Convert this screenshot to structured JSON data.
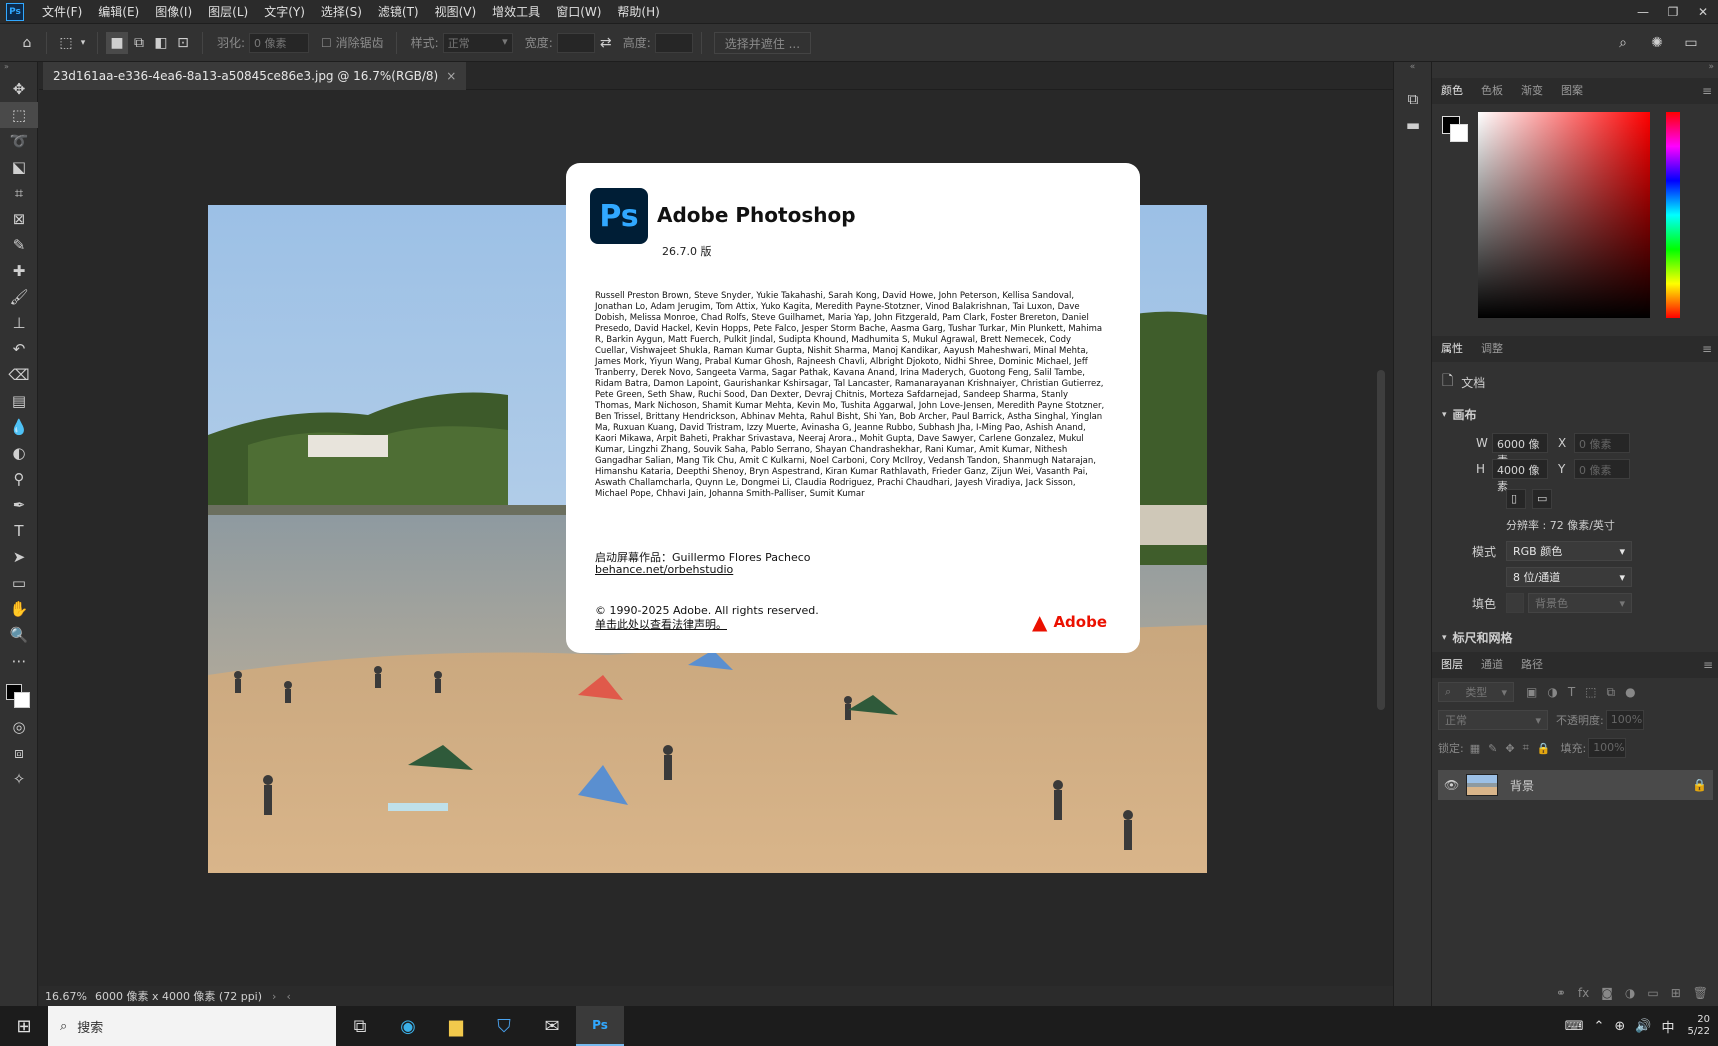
{
  "menubar": {
    "app_badge": "Ps",
    "items": [
      "文件(F)",
      "编辑(E)",
      "图像(I)",
      "图层(L)",
      "文字(Y)",
      "选择(S)",
      "滤镜(T)",
      "视图(V)",
      "增效工具",
      "窗口(W)",
      "帮助(H)"
    ],
    "win_minimize": "—",
    "win_restore": "❐",
    "win_close": "✕"
  },
  "options": {
    "feather_label": "羽化:",
    "feather_value": "0 像素",
    "antialias_label": "消除锯齿",
    "style_label": "样式:",
    "style_value": "正常",
    "width_label": "宽度:",
    "height_label": "高度:",
    "select_mask_button": "选择并遮住 ..."
  },
  "document": {
    "tab_title": "23d161aa-e336-4ea6-8a13-a50845ce86e3.jpg @ 16.7%(RGB/8)",
    "tab_close": "×",
    "zoom": "16.67%",
    "doc_size": "6000 像素 x 4000 像素 (72 ppi)"
  },
  "about": {
    "logo": "Ps",
    "title": "Adobe Photoshop",
    "version": "26.7.0 版",
    "credits": "Russell Preston Brown, Steve Snyder, Yukie Takahashi, Sarah Kong, David Howe, John Peterson, Kellisa Sandoval, Jonathan Lo, Adam Jerugim, Tom Attix, Yuko Kagita, Meredith Payne-Stotzner, Vinod Balakrishnan, Tai Luxon, Dave Dobish, Melissa Monroe, Chad Rolfs, Steve Guilhamet, Maria Yap, John Fitzgerald, Pam Clark, Foster Brereton, Daniel Presedo, David Hackel, Kevin Hopps, Pete Falco, Jesper Storm Bache, Aasma Garg, Tushar Turkar, Min Plunkett, Mahima R, Barkin Aygun, Matt Fuerch, Pulkit Jindal, Sudipta Khound, Madhumita S, Mukul Agrawal, Brett Nemecek, Cody Cuellar, Vishwajeet Shukla, Raman Kumar Gupta, Nishit Sharma, Manoj Kandikar, Aayush Maheshwari, Minal Mehta, James Mork, Yiyun Wang, Prabal Kumar Ghosh, Rajneesh Chavli, Albright Djokoto, Nidhi Shree, Dominic Michael, Jeff Tranberry, Derek Novo, Sangeeta Varma, Sagar Pathak, Kavana Anand, Irina Maderych, Guotong Feng, Salil Tambe, Ridam Batra, Damon Lapoint, Gaurishankar Kshirsagar, Tal Lancaster, Ramanarayanan Krishnaiyer, Christian Gutierrez, Pete Green, Seth Shaw, Ruchi Sood, Dan Dexter, Devraj Chitnis, Morteza Safdarnejad, Sandeep Sharma, Stanly Thomas, Mark Nichoson, Shamit Kumar Mehta, Kevin Mo, Tushita Aggarwal, John Love-Jensen, Meredith Payne Stotzner, Ben Trissel, Brittany Hendrickson, Abhinav Mehta, Rahul Bisht, Shi Yan, Bob Archer, Paul Barrick, Astha Singhal, Yinglan Ma, Ruxuan Kuang, David Tristram, Izzy Muerte, Avinasha G, Jeanne Rubbo, Subhash Jha, I-Ming Pao, Ashish Anand, Kaori Mikawa, Arpit Baheti, Prakhar Srivastava, Neeraj Arora., Mohit Gupta, Dave Sawyer, Carlene Gonzalez, Mukul Kumar, Lingzhi Zhang, Souvik Saha, Pablo Serrano, Shayan Chandrashekhar, Rani Kumar, Amit Kumar, Nithesh Gangadhar Salian, Mang Tik Chu, Amit C Kulkarni, Noel Carboni, Cory McIlroy, Vedansh Tandon, Shanmugh Natarajan, Himanshu Kataria, Deepthi Shenoy, Bryn Aspestrand, Kiran Kumar Rathlavath, Frieder Ganz, Zijun Wei, Vasanth Pai, Aswath Challamcharla, Quynn Le, Dongmei Li, Claudia Rodriguez, Prachi Chaudhari, Jayesh Viradiya, Jack Sisson, Michael Pope, Chhavi Jain, Johanna Smith-Palliser, Sumit Kumar",
    "splash_label": "启动屏幕作品：",
    "splash_author": "Guillermo Flores Pacheco",
    "splash_link": "behance.net/orbehstudio",
    "copyright": "© 1990-2025 Adobe. All rights reserved.",
    "legal_link": "单击此处以查看法律声明。",
    "brand": "Adobe"
  },
  "color_panel": {
    "tabs": [
      "颜色",
      "色板",
      "渐变",
      "图案"
    ]
  },
  "properties_panel": {
    "tabs": [
      "属性",
      "调整"
    ],
    "doc_label": "文档",
    "canvas_section": "画布",
    "w_label": "W",
    "w_value": "6000 像素",
    "h_label": "H",
    "h_value": "4000 像素",
    "x_label": "X",
    "x_placeholder": "0 像素",
    "y_label": "Y",
    "y_placeholder": "0 像素",
    "resolution": "分辨率 : 72 像素/英寸",
    "mode_label": "模式",
    "mode_value": "RGB 颜色",
    "depth_value": "8 位/通道",
    "fill_label": "填色",
    "fill_value": "背景色",
    "rulers_section": "标尺和网格"
  },
  "layers_panel": {
    "tabs": [
      "图层",
      "通道",
      "路径"
    ],
    "filter_placeholder": "类型",
    "blend_mode": "正常",
    "opacity_label": "不透明度:",
    "opacity_value": "100%",
    "lock_label": "锁定:",
    "fill_label": "填充:",
    "fill_value": "100%",
    "layer_name": "背景"
  },
  "taskbar": {
    "search_label": "搜索",
    "ime": "中",
    "time": "20",
    "date": "5/22"
  },
  "colors": {
    "accent": "#31a8ff",
    "adobe_red": "#eb1000",
    "app_bg": "#282828",
    "panel_bg": "#323232"
  }
}
